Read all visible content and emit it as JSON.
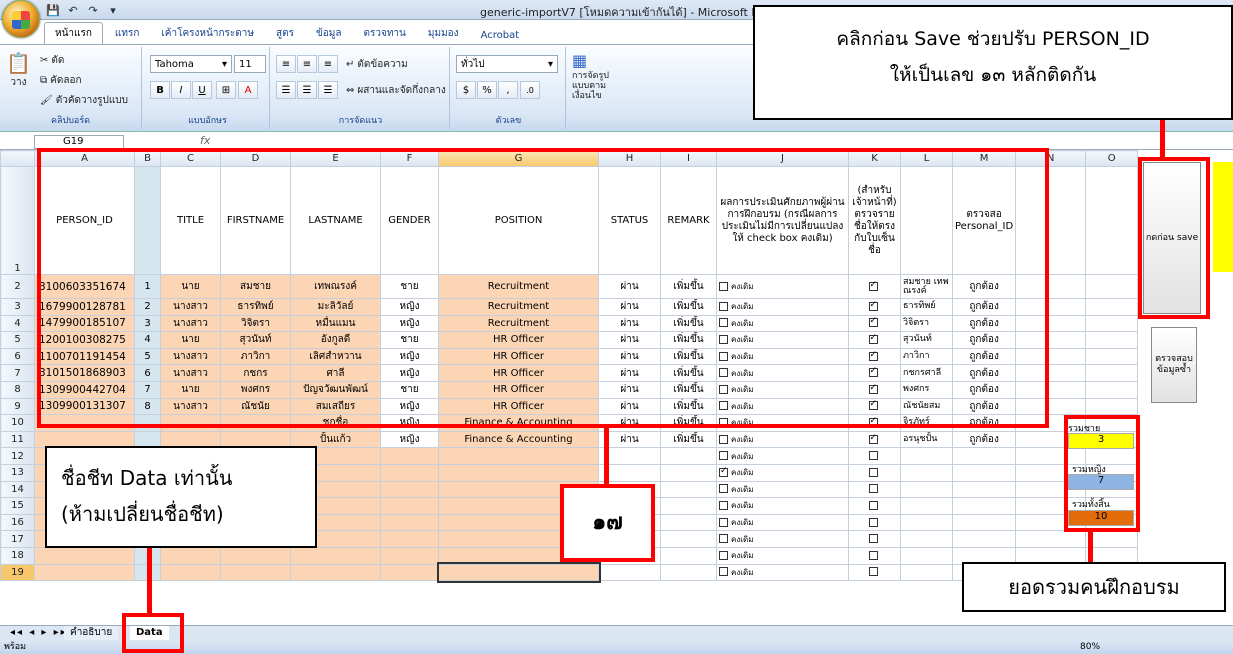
{
  "window": {
    "title": "generic-importV7  [โหมดความเข้ากันได้] - Microsoft Exc"
  },
  "ribbon_tabs": [
    "หน้าแรก",
    "แทรก",
    "เค้าโครงหน้ากระดาษ",
    "สูตร",
    "ข้อมูล",
    "ตรวจทาน",
    "มุมมอง",
    "Acrobat"
  ],
  "ribbon": {
    "clipboard": {
      "cut": "ตัด",
      "copy": "คัดลอก",
      "paste": "วาง",
      "format_painter": "ตัวคัดวางรูปแบบ",
      "label": "คลิปบอร์ด"
    },
    "font": {
      "name": "Tahoma",
      "size": "11",
      "label": "แบบอักษร"
    },
    "alignment": {
      "wrap": "ตัดข้อความ",
      "merge": "ผสานและจัดกึ่งกลาง",
      "label": "การจัดแนว"
    },
    "number": {
      "format": "ทั่วไป",
      "label": "ตัวเลข"
    },
    "styles": {
      "conditional": "การจัดรูปแบบตามเงื่อนไข"
    }
  },
  "formula_bar": {
    "cell_ref": "G19",
    "fx": "fx"
  },
  "columns": [
    "A",
    "B",
    "C",
    "D",
    "E",
    "F",
    "G",
    "H",
    "I",
    "J",
    "K",
    "L",
    "M",
    "N",
    "O"
  ],
  "headers": {
    "A": "PERSON_ID",
    "C": "TITLE",
    "D": "FIRSTNAME",
    "E": "LASTNAME",
    "F": "GENDER",
    "G": "POSITION",
    "H": "STATUS",
    "I": "REMARK",
    "J": "ผลการประเมินศักยภาพผู้ผ่านการฝึกอบรม (กรณีผลการประเมินไม่มีการเปลี่ยนแปลงให้ check box คงเดิม)",
    "K": "(สำหรับเจ้าหน้าที่) ตรวจรายชื่อให้ตรงกับใบเซ็นชื่อ",
    "M": "ตรวจสอ Personal_ID"
  },
  "rows": [
    {
      "id": "3100603351674",
      "no": "1",
      "title": "นาย",
      "first": "สมชาย",
      "last": "เทพณรงค์",
      "gender": "ชาย",
      "position": "Recruitment",
      "status": "ผ่าน",
      "remark": "เพิ่มขึ้น",
      "eval": "คงเดิม",
      "eval_checked": false,
      "checked": true,
      "name_check": "สมชาย เทพณรงค์",
      "pid_check": "ถูกต้อง"
    },
    {
      "id": "1679900128781",
      "no": "2",
      "title": "นางสาว",
      "first": "ธารทิพย์",
      "last": "มะลิวัลย์",
      "gender": "หญิง",
      "position": "Recruitment",
      "status": "ผ่าน",
      "remark": "เพิ่มขึ้น",
      "eval": "คงเดิม",
      "eval_checked": false,
      "checked": true,
      "name_check": "ธารทิพย์",
      "pid_check": "ถูกต้อง"
    },
    {
      "id": "1479900185107",
      "no": "3",
      "title": "นางสาว",
      "first": "วิจิตรา",
      "last": "หมื่นแมน",
      "gender": "หญิง",
      "position": "Recruitment",
      "status": "ผ่าน",
      "remark": "เพิ่มขึ้น",
      "eval": "คงเดิม",
      "eval_checked": false,
      "checked": true,
      "name_check": "วิจิตรา",
      "pid_check": "ถูกต้อง"
    },
    {
      "id": "1200100308275",
      "no": "4",
      "title": "นาย",
      "first": "สุวนันท์",
      "last": "อังกูลดี",
      "gender": "ชาย",
      "position": "HR Officer",
      "status": "ผ่าน",
      "remark": "เพิ่มขึ้น",
      "eval": "คงเดิม",
      "eval_checked": false,
      "checked": true,
      "name_check": "สุวนันท์",
      "pid_check": "ถูกต้อง"
    },
    {
      "id": "1100701191454",
      "no": "5",
      "title": "นางสาว",
      "first": "ภาวิกา",
      "last": "เลิศสำหวาน",
      "gender": "หญิง",
      "position": "HR Officer",
      "status": "ผ่าน",
      "remark": "เพิ่มขึ้น",
      "eval": "คงเดิม",
      "eval_checked": false,
      "checked": true,
      "name_check": "ภาวิกา",
      "pid_check": "ถูกต้อง"
    },
    {
      "id": "3101501868903",
      "no": "6",
      "title": "นางสาว",
      "first": "กชกร",
      "last": "ศาลี",
      "gender": "หญิง",
      "position": "HR Officer",
      "status": "ผ่าน",
      "remark": "เพิ่มขึ้น",
      "eval": "คงเดิม",
      "eval_checked": false,
      "checked": true,
      "name_check": "กชกรศาลี",
      "pid_check": "ถูกต้อง"
    },
    {
      "id": "1309900442704",
      "no": "7",
      "title": "นาย",
      "first": "พงศกร",
      "last": "ปัญจวัฒนพัฒน์",
      "gender": "ชาย",
      "position": "HR Officer",
      "status": "ผ่าน",
      "remark": "เพิ่มขึ้น",
      "eval": "คงเดิม",
      "eval_checked": false,
      "checked": true,
      "name_check": "พงศกร",
      "pid_check": "ถูกต้อง"
    },
    {
      "id": "1309900131307",
      "no": "8",
      "title": "นางสาว",
      "first": "ณัชนัย",
      "last": "สมเสถียร",
      "gender": "หญิง",
      "position": "HR Officer",
      "status": "ผ่าน",
      "remark": "เพิ่มขึ้น",
      "eval": "คงเดิม",
      "eval_checked": false,
      "checked": true,
      "name_check": "ณัชนัยสม",
      "pid_check": "ถูกต้อง"
    },
    {
      "id": "",
      "no": "",
      "title": "",
      "first": "",
      "last": "ชกชื่อ",
      "gender": "หญิง",
      "position": "Finance & Accounting",
      "status": "ผ่าน",
      "remark": "เพิ่มขึ้น",
      "eval": "คงเดิม",
      "eval_checked": false,
      "checked": true,
      "name_check": "จิรภัทร์",
      "pid_check": "ถูกต้อง"
    },
    {
      "id": "",
      "no": "",
      "title": "",
      "first": "",
      "last": "ปั้นแก้ว",
      "gender": "หญิง",
      "position": "Finance & Accounting",
      "status": "ผ่าน",
      "remark": "เพิ่มขึ้น",
      "eval": "คงเดิม",
      "eval_checked": false,
      "checked": true,
      "name_check": "อรนุชปั้น",
      "pid_check": "ถูกต้อง"
    },
    {
      "eval": "คงเดิม",
      "eval_checked": false,
      "checked": false
    },
    {
      "eval": "คงเดิม",
      "eval_checked": true,
      "checked": false
    },
    {
      "eval": "คงเดิม",
      "eval_checked": false,
      "checked": false
    },
    {
      "eval": "คงเดิม",
      "eval_checked": false,
      "checked": false
    },
    {
      "eval": "คงเดิม",
      "eval_checked": false,
      "checked": false
    },
    {
      "eval": "คงเดิม",
      "eval_checked": false,
      "checked": false
    },
    {
      "eval": "คงเดิม",
      "eval_checked": false,
      "checked": false
    },
    {
      "eval": "คงเดิม",
      "eval_checked": false,
      "checked": false
    }
  ],
  "side_buttons": {
    "save": "กดก่อน save",
    "check_dup": "ตรวจสอบข้อมูลซ้ำ"
  },
  "summary": {
    "male_label": "รวมชาย",
    "male": "3",
    "female_label": "รวมหญิง",
    "female": "7",
    "total_label": "รวมทั้งสิ้น",
    "total": "10"
  },
  "row_col_side": [
    "ก",
    "1",
    "2",
    "ต",
    "3",
    "ต",
    "4",
    "5",
    "6"
  ],
  "callouts": {
    "save": "คลิกก่อน Save  ช่วยปรับ PERSON_ID\nให้เป็นเลข ๑๓ หลักติดกัน",
    "sheet_name": "ชื่อชีท Data เท่านั้น\n(ห้ามเปลี่ยนชื่อชีท)",
    "seventeen": "๑๗",
    "total": "ยอดรวมคนฝึกอบรม"
  },
  "sheet_tabs": [
    "คำอธิบาย",
    "Data"
  ],
  "status": {
    "ready": "พร้อม",
    "zoom": "80%"
  },
  "colors": {
    "orange": "#fcd5b5",
    "blue": "#d6e6ef",
    "yellow": "#ffff00",
    "purple": "#8db4e2",
    "dark_orange": "#e26b0a",
    "red": "#ff0000"
  }
}
